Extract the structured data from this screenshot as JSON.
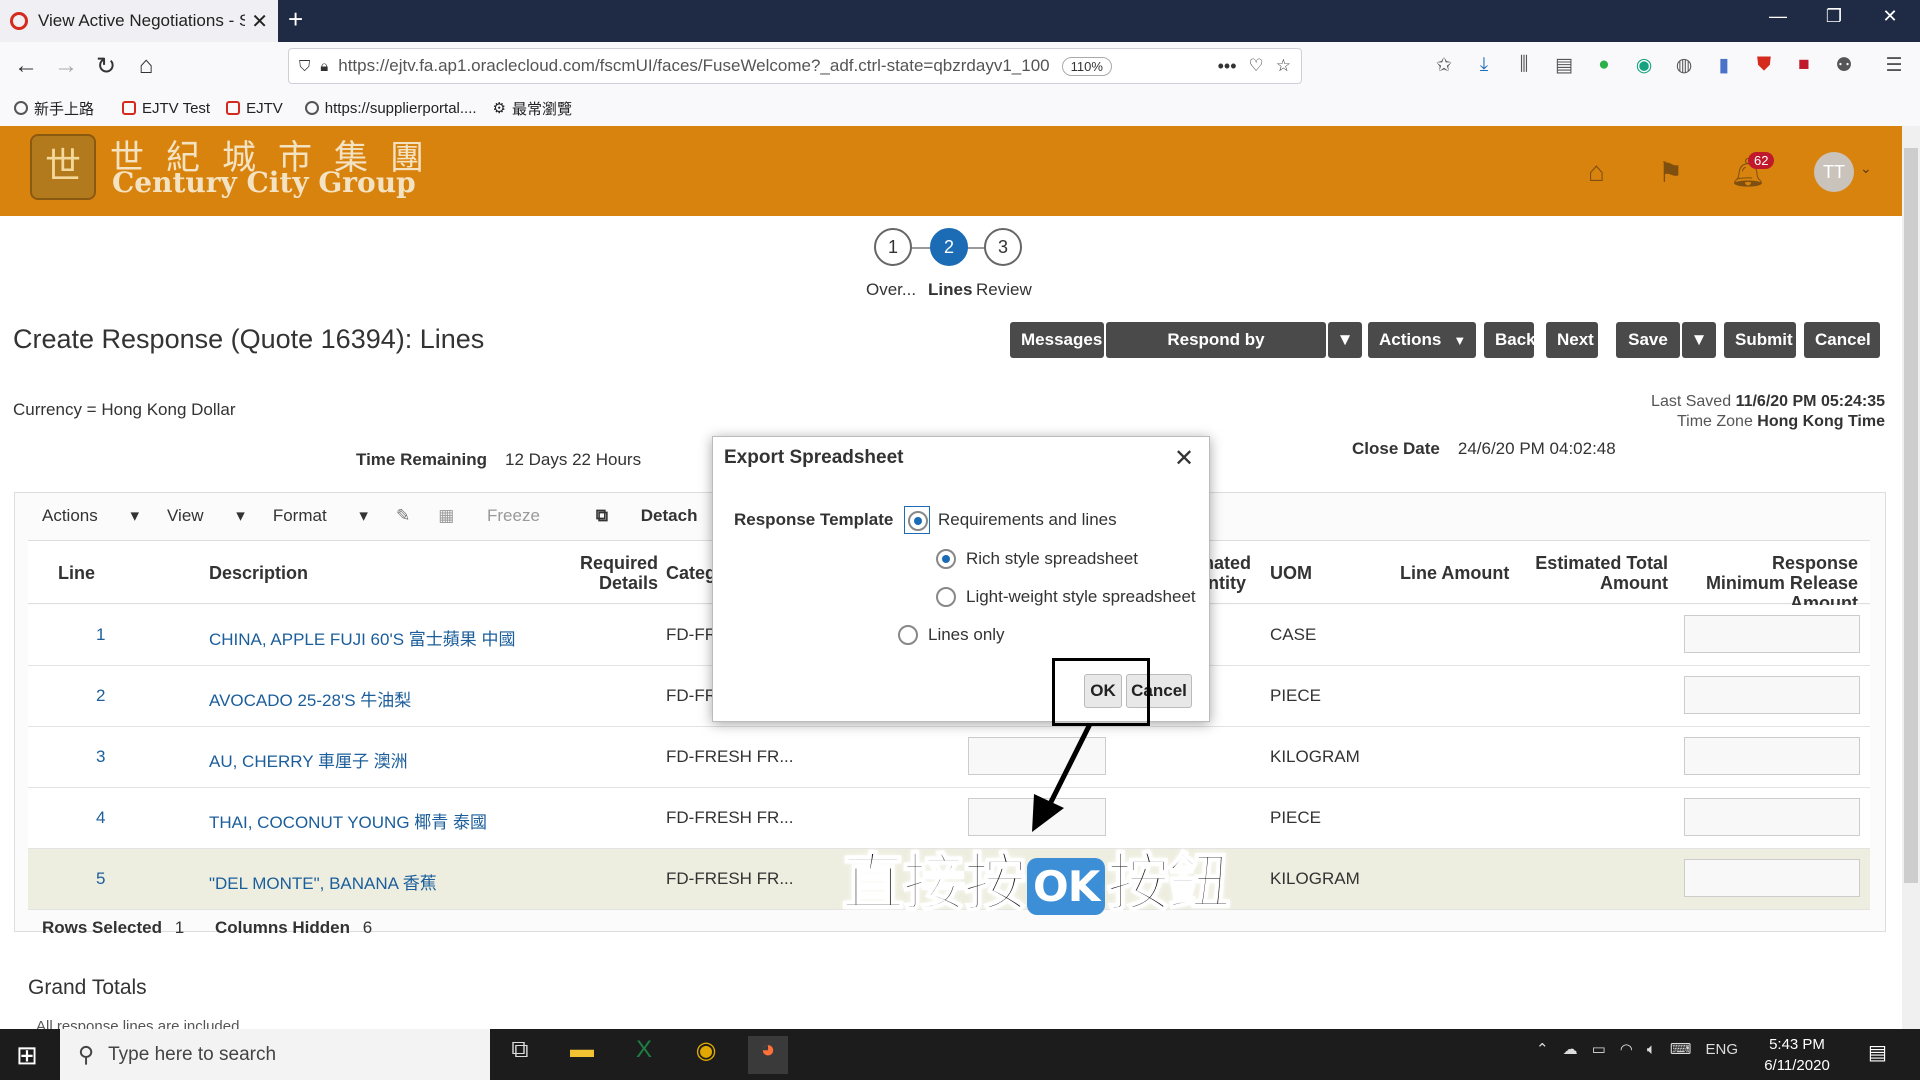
{
  "browser": {
    "tab_title": "View Active Negotiations - Sup",
    "url": "https://ejtv.fa.ap1.oraclecloud.com/fscmUI/faces/FuseWelcome?_adf.ctrl-state=qbzrdayv1_100",
    "zoom": "110%",
    "bookmarks": [
      "新手上路",
      "EJTV Test",
      "EJTV",
      "https://supplierportal....",
      "最常瀏覽"
    ]
  },
  "header": {
    "logo_cn": "世紀城市集團",
    "logo_en": "Century City Group",
    "notif_count": "62",
    "avatar": "TT"
  },
  "train": {
    "steps": [
      {
        "num": "1",
        "label": "Over..."
      },
      {
        "num": "2",
        "label": "Lines"
      },
      {
        "num": "3",
        "label": "Review"
      }
    ]
  },
  "page": {
    "title": "Create Response (Quote 16394): Lines",
    "buttons": {
      "messages": "Messages",
      "respond": "Respond by Spreadsheet",
      "actions": "Actions",
      "back": "Back",
      "next": "Next",
      "save": "Save",
      "submit": "Submit",
      "cancel": "Cancel"
    },
    "currency": "Currency = Hong Kong Dollar",
    "last_saved_label": "Last Saved",
    "last_saved": "11/6/20 PM 05:24:35",
    "time_zone_label": "Time Zone",
    "time_zone": "Hong Kong Time",
    "time_remaining_label": "Time Remaining",
    "time_remaining": "12 Days 22 Hours",
    "close_date_label": "Close Date",
    "close_date": "24/6/20 PM 04:02:48"
  },
  "table": {
    "toolbar": {
      "actions": "Actions",
      "view": "View",
      "format": "Format",
      "freeze": "Freeze",
      "detach": "Detach"
    },
    "headers": {
      "line": "Line",
      "description": "Description",
      "required_details": "Required Details",
      "category": "Categ",
      "quantity": "mated antity",
      "uom": "UOM",
      "line_amount": "Line Amount",
      "est_total": "Estimated Total Amount",
      "resp_min": "Response Minimum Release Amount"
    },
    "rows": [
      {
        "line": "1",
        "description": "CHINA, APPLE FUJI 60'S 富士蘋果 中國",
        "category": "FD-FR",
        "uom": "CASE"
      },
      {
        "line": "2",
        "description": "AVOCADO 25-28'S 牛油梨",
        "category": "FD-FR",
        "uom": "PIECE"
      },
      {
        "line": "3",
        "description": "AU, CHERRY 車厘子 澳洲",
        "category": "FD-FRESH FR...",
        "uom": "KILOGRAM"
      },
      {
        "line": "4",
        "description": "THAI, COCONUT YOUNG 椰青 泰國",
        "category": "FD-FRESH FR...",
        "uom": "PIECE"
      },
      {
        "line": "5",
        "description": "\"DEL MONTE\", BANANA 香蕉",
        "category": "FD-FRESH FR...",
        "uom": "KILOGRAM"
      }
    ],
    "rows_selected_label": "Rows Selected",
    "rows_selected": "1",
    "columns_hidden_label": "Columns Hidden",
    "columns_hidden": "6",
    "grand_totals": "Grand Totals",
    "all_response": "All response lines are included"
  },
  "dialog": {
    "title": "Export Spreadsheet",
    "template_label": "Response Template",
    "opt_req": "Requirements and lines",
    "opt_rich": "Rich style spreadsheet",
    "opt_light": "Light-weight style spreadsheet",
    "opt_lines": "Lines only",
    "ok": "OK",
    "cancel": "Cancel"
  },
  "annotation": {
    "before": "直接按",
    "ok": "OK",
    "after": "按鈕"
  },
  "taskbar": {
    "search_placeholder": "Type here to search",
    "lang": "ENG",
    "time": "5:43 PM",
    "date": "6/11/2020"
  },
  "colors": {
    "header_bg": "#d9830f",
    "step_active": "#1b6cb5",
    "button_dark": "#4a4a4a",
    "link": "#1b5e9b"
  }
}
